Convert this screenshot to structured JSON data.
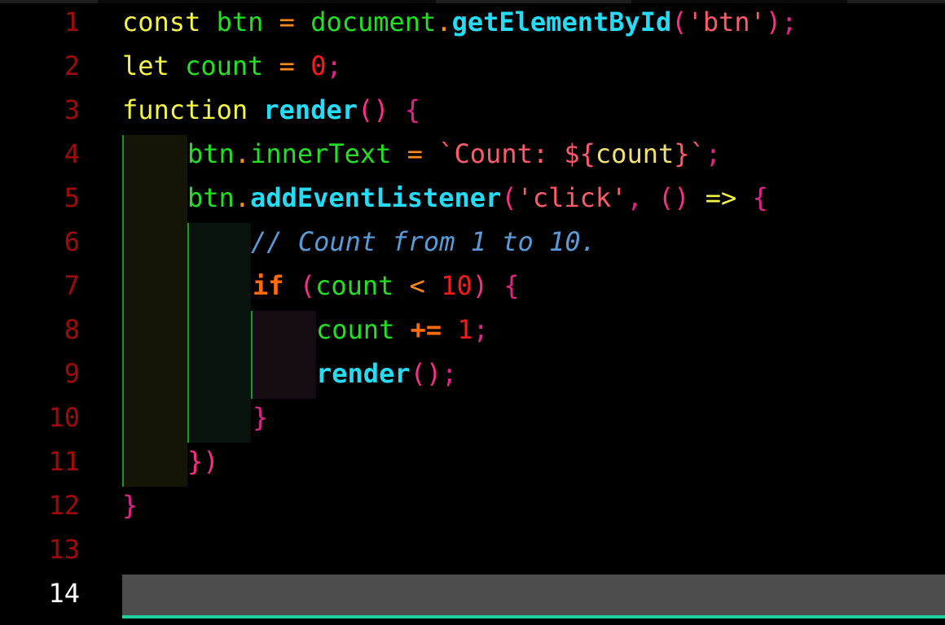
{
  "editor": {
    "line_numbers": [
      "1",
      "2",
      "3",
      "4",
      "5",
      "6",
      "7",
      "8",
      "9",
      "10",
      "11",
      "12",
      "13",
      "14"
    ],
    "current_line": "14",
    "lines": [
      [
        {
          "t": "const",
          "c": "kw"
        },
        {
          "t": " ",
          "c": ""
        },
        {
          "t": "btn",
          "c": "var"
        },
        {
          "t": " = ",
          "c": "op"
        },
        {
          "t": "document",
          "c": "var"
        },
        {
          "t": ".",
          "c": "op"
        },
        {
          "t": "getElementById",
          "c": "fn"
        },
        {
          "t": "(",
          "c": "paren"
        },
        {
          "t": "'btn'",
          "c": "str"
        },
        {
          "t": ")",
          "c": "paren"
        },
        {
          "t": ";",
          "c": "punc"
        }
      ],
      [
        {
          "t": "let",
          "c": "kw"
        },
        {
          "t": " ",
          "c": ""
        },
        {
          "t": "count",
          "c": "var"
        },
        {
          "t": " = ",
          "c": "op"
        },
        {
          "t": "0",
          "c": "num"
        },
        {
          "t": ";",
          "c": "punc"
        }
      ],
      [
        {
          "t": "function",
          "c": "kw"
        },
        {
          "t": " ",
          "c": ""
        },
        {
          "t": "render",
          "c": "fn"
        },
        {
          "t": "()",
          "c": "paren"
        },
        {
          "t": " {",
          "c": "punc"
        }
      ],
      [
        {
          "t": "btn",
          "c": "var"
        },
        {
          "t": ".",
          "c": "op"
        },
        {
          "t": "innerText",
          "c": "var"
        },
        {
          "t": " = ",
          "c": "op"
        },
        {
          "t": "`Count: ${",
          "c": "tpl"
        },
        {
          "t": "count",
          "c": "interp"
        },
        {
          "t": "}`",
          "c": "tpl"
        },
        {
          "t": ";",
          "c": "punc"
        }
      ],
      [
        {
          "t": "btn",
          "c": "var"
        },
        {
          "t": ".",
          "c": "op"
        },
        {
          "t": "addEventListener",
          "c": "fn"
        },
        {
          "t": "(",
          "c": "paren"
        },
        {
          "t": "'click'",
          "c": "str"
        },
        {
          "t": ", ",
          "c": "punc"
        },
        {
          "t": "()",
          "c": "paren"
        },
        {
          "t": " => ",
          "c": "arrow"
        },
        {
          "t": "{",
          "c": "punc"
        }
      ],
      [
        {
          "t": "// Count from 1 to 10.",
          "c": "comment"
        }
      ],
      [
        {
          "t": "if",
          "c": "kw2"
        },
        {
          "t": " ",
          "c": ""
        },
        {
          "t": "(",
          "c": "paren"
        },
        {
          "t": "count",
          "c": "var"
        },
        {
          "t": " < ",
          "c": "op"
        },
        {
          "t": "10",
          "c": "num"
        },
        {
          "t": ")",
          "c": "paren"
        },
        {
          "t": " {",
          "c": "punc"
        }
      ],
      [
        {
          "t": "count",
          "c": "var"
        },
        {
          "t": " += ",
          "c": "kw2"
        },
        {
          "t": "1",
          "c": "num"
        },
        {
          "t": ";",
          "c": "punc"
        }
      ],
      [
        {
          "t": "render",
          "c": "fn"
        },
        {
          "t": "()",
          "c": "paren"
        },
        {
          "t": ";",
          "c": "punc"
        }
      ],
      [
        {
          "t": "}",
          "c": "punc"
        }
      ],
      [
        {
          "t": "})",
          "c": "paren"
        }
      ],
      [
        {
          "t": "}",
          "c": "punc"
        }
      ]
    ]
  },
  "colors": {
    "background": "#000000",
    "line_number": "#a10a0a",
    "line_number_current": "#ffffff",
    "current_line_highlight": "#4d4d4d",
    "cursor_underline": "#1ed0a0",
    "indent_guide": "#1f8f1f"
  }
}
